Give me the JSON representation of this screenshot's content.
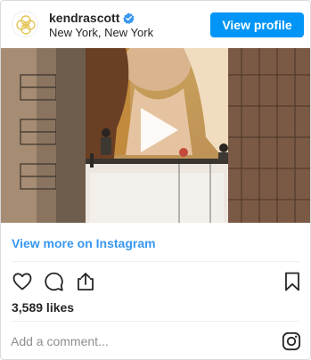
{
  "header": {
    "username": "kendrascott",
    "location": "New York, New York",
    "view_profile_label": "View profile",
    "verified": true
  },
  "media": {
    "type": "video",
    "description_icon": "play-icon"
  },
  "links": {
    "view_more_label": "View more on Instagram"
  },
  "actions": {
    "icons": [
      "heart-icon",
      "comment-icon",
      "share-icon",
      "bookmark-icon"
    ]
  },
  "likes": {
    "label": "3,589 likes"
  },
  "comment": {
    "placeholder": "Add a comment...",
    "icon": "instagram-icon"
  },
  "colors": {
    "accent": "#0095f6",
    "link": "#3897f0",
    "text": "#262626",
    "muted": "#8e8e8e",
    "divider": "#efefef",
    "brand_gold": "#e6c65a"
  }
}
